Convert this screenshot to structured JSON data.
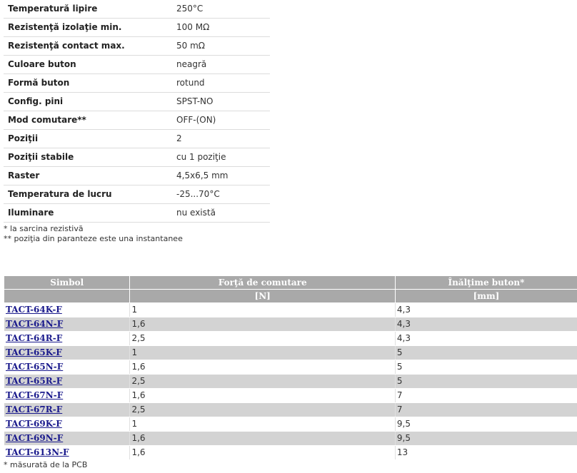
{
  "specs": [
    {
      "label": "Temperatură lipire",
      "value": "250°C"
    },
    {
      "label": "Rezistenţă izolaţie min.",
      "value": "100 MΩ"
    },
    {
      "label": "Rezistenţă contact max.",
      "value": "50 mΩ"
    },
    {
      "label": "Culoare buton",
      "value": "neagră"
    },
    {
      "label": "Formă buton",
      "value": "rotund"
    },
    {
      "label": "Config. pini",
      "value": "SPST-NO"
    },
    {
      "label": "Mod comutare**",
      "value": "OFF-(ON)"
    },
    {
      "label": "Poziţii",
      "value": "2"
    },
    {
      "label": "Poziţii stabile",
      "value": "cu 1 poziţie"
    },
    {
      "label": "Raster",
      "value": "4,5x6,5 mm"
    },
    {
      "label": "Temperatura de lucru",
      "value": "-25...70°C"
    },
    {
      "label": "Iluminare",
      "value": "nu există"
    }
  ],
  "notes": [
    "* la sarcina rezistivă",
    "** poziţia din paranteze este una instantanee"
  ],
  "products": {
    "headers": [
      "Simbol",
      "Forţă de comutare",
      "Înălţime buton*"
    ],
    "units": [
      "",
      "[N]",
      "[mm]"
    ],
    "rows": [
      {
        "symbol": "TACT-64K-F",
        "force": "1",
        "height": "4,3"
      },
      {
        "symbol": "TACT-64N-F",
        "force": "1,6",
        "height": "4,3"
      },
      {
        "symbol": "TACT-64R-F",
        "force": "2,5",
        "height": "4,3"
      },
      {
        "symbol": "TACT-65K-F",
        "force": "1",
        "height": "5"
      },
      {
        "symbol": "TACT-65N-F",
        "force": "1,6",
        "height": "5"
      },
      {
        "symbol": "TACT-65R-F",
        "force": "2,5",
        "height": "5"
      },
      {
        "symbol": "TACT-67N-F",
        "force": "1,6",
        "height": "7"
      },
      {
        "symbol": "TACT-67R-F",
        "force": "2,5",
        "height": "7"
      },
      {
        "symbol": "TACT-69K-F",
        "force": "1",
        "height": "9,5"
      },
      {
        "symbol": "TACT-69N-F",
        "force": "1,6",
        "height": "9,5"
      },
      {
        "symbol": "TACT-613N-F",
        "force": "1,6",
        "height": "13"
      }
    ],
    "footnote": "* măsurată de la PCB"
  }
}
